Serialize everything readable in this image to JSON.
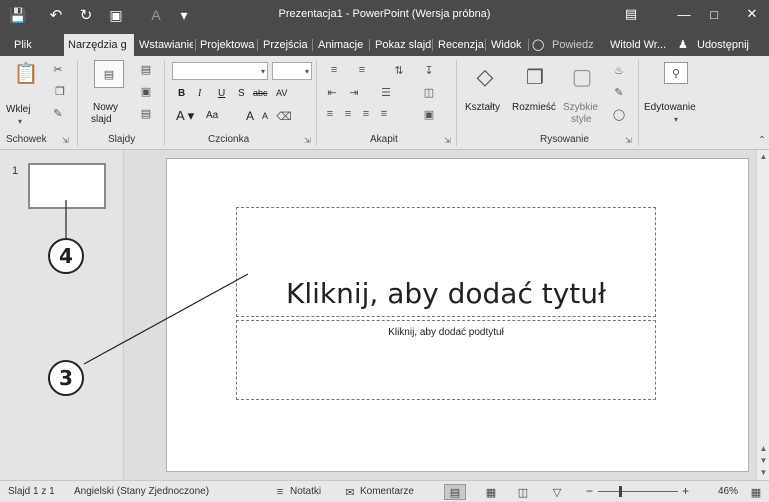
{
  "title_bar": {
    "title": "Prezentacja1 - PowerPoint (Wersja próbna)",
    "icons": [
      "save-icon",
      "undo-icon",
      "redo-icon",
      "start-from-beginning-icon",
      "font-color-icon",
      "customize-qat-icon",
      "ribbon-display-options-icon",
      "minimize-icon",
      "maximize-icon",
      "close-icon"
    ]
  },
  "tabs": [
    {
      "label": "Plik"
    },
    {
      "label": "Narzędzia g",
      "active": true
    },
    {
      "label": "Wstawianie"
    },
    {
      "label": "Projektowa"
    },
    {
      "label": "Przejścia"
    },
    {
      "label": "Animacje"
    },
    {
      "label": "Pokaz slajd"
    },
    {
      "label": "Recenzja"
    },
    {
      "label": "Widok"
    },
    {
      "label": "Powiedz"
    },
    {
      "label": "Witold Wr..."
    },
    {
      "label": "Udostępnij"
    }
  ],
  "ribbon": {
    "clipboard": {
      "paste": "Wklej",
      "group": "Schowek"
    },
    "slides": {
      "new_slide_line1": "Nowy",
      "new_slide_line2": "slajd",
      "group": "Slajdy"
    },
    "font": {
      "group": "Czcionka",
      "bold": "B",
      "italic": "I",
      "underline": "U",
      "shadow": "S",
      "strike": "abc",
      "spacing": "AV",
      "case": "Aa",
      "grow": "A",
      "shrink": "A"
    },
    "paragraph": {
      "group": "Akapit"
    },
    "drawing": {
      "shapes": "Kształty",
      "arrange": "Rozmieść",
      "quick_styles_line1": "Szybkie",
      "quick_styles_line2": "style",
      "group": "Rysowanie"
    },
    "editing": {
      "label": "Edytowanie"
    }
  },
  "thumbnails": [
    {
      "number": "1"
    }
  ],
  "slide": {
    "title_placeholder": "Kliknij, aby dodać tytuł",
    "subtitle_placeholder": "Kliknij, aby dodać podtytuł"
  },
  "callouts": [
    "4",
    "3"
  ],
  "status_bar": {
    "slide_info": "Slajd 1 z 1",
    "language": "Angielski (Stany Zjednoczone)",
    "notes": "Notatki",
    "comments": "Komentarze",
    "zoom": "46%"
  }
}
